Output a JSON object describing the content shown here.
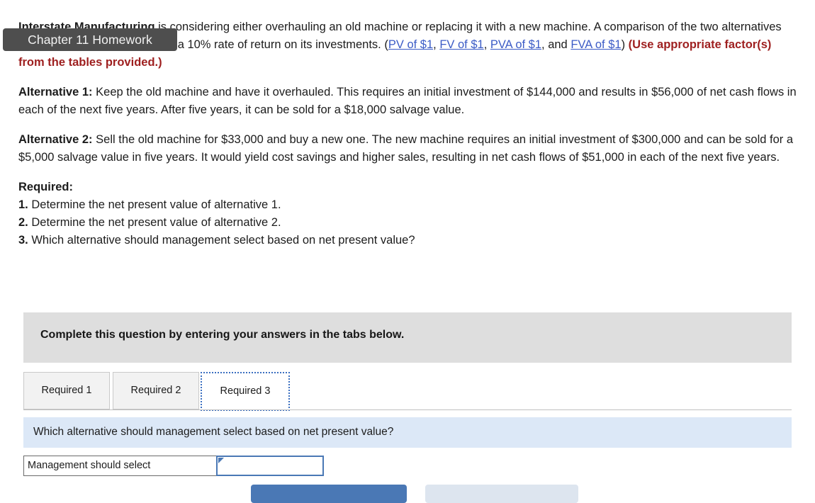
{
  "tooltip": {
    "label": "Chapter 11 Homework"
  },
  "problem": {
    "intro_part1": "Interstate Manufacturing",
    "intro_part2": " is considering either overhauling an old machine or replacing it with a new machine. A comparison of the two alternatives follows. Management requires a 10% rate of return on its investments. (",
    "links": [
      {
        "label": "PV of $1"
      },
      {
        "label": "FV of $1"
      },
      {
        "label": "PVA of $1"
      },
      {
        "label": "FVA of $1"
      }
    ],
    "link_separator_1": ", ",
    "link_separator_2": ", ",
    "link_separator_3": ", and ",
    "intro_close": ") ",
    "intro_red": "(Use appropriate factor(s) from the tables provided.)",
    "alternative_1_label": "Alternative 1:",
    "alternative_1_text": " Keep the old machine and have it overhauled. This requires an initial investment of $144,000 and results in $56,000 of net cash flows in each of the next five years. After five years, it can be sold for a $18,000 salvage value.",
    "alternative_2_label": "Alternative 2:",
    "alternative_2_text": " Sell the old machine for $33,000 and buy a new one. The new machine requires an initial investment of $300,000 and can be sold for a $5,000 salvage value in five years. It would yield cost savings and higher sales, resulting in net cash flows of $51,000 in each of the next five years.",
    "required_heading": "Required:",
    "required_items": [
      {
        "number": "1.",
        "text": " Determine the net present value of alternative 1."
      },
      {
        "number": "2.",
        "text": " Determine the net present value of alternative 2."
      },
      {
        "number": "3.",
        "text": " Which alternative should management select based on net present value?"
      }
    ]
  },
  "instruction": {
    "text": "Complete this question by entering your answers in the tabs below."
  },
  "tabs": [
    {
      "label": "Required 1",
      "active": false
    },
    {
      "label": "Required 2",
      "active": false
    },
    {
      "label": "Required 3",
      "active": true
    }
  ],
  "question_bar": {
    "text": "Which alternative should management select based on net present value?"
  },
  "answer_row": {
    "label": "Management should select",
    "value": "",
    "placeholder": ""
  },
  "buttons": {
    "primary_label": "",
    "secondary_label": ""
  },
  "colors": {
    "link": "#3b5bc6",
    "red": "#9e1f1f",
    "tab_active_border": "#3b6fc0",
    "question_bar_bg": "#dce8f7",
    "instruction_bg": "#dedede",
    "primary_button": "#4a78b5",
    "secondary_button": "#dde5ef",
    "tooltip_bg": "#4e4e4e"
  }
}
